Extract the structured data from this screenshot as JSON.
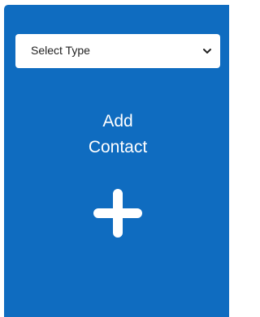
{
  "select_type": {
    "selected_label": "Select Type",
    "icon": "chevron-down-icon"
  },
  "add_contact": {
    "line1": "Add",
    "line2": "Contact",
    "icon": "plus-icon"
  },
  "colors": {
    "panel_background": "#0f6cc0",
    "text_on_panel": "#ffffff",
    "select_background": "#ffffff"
  }
}
